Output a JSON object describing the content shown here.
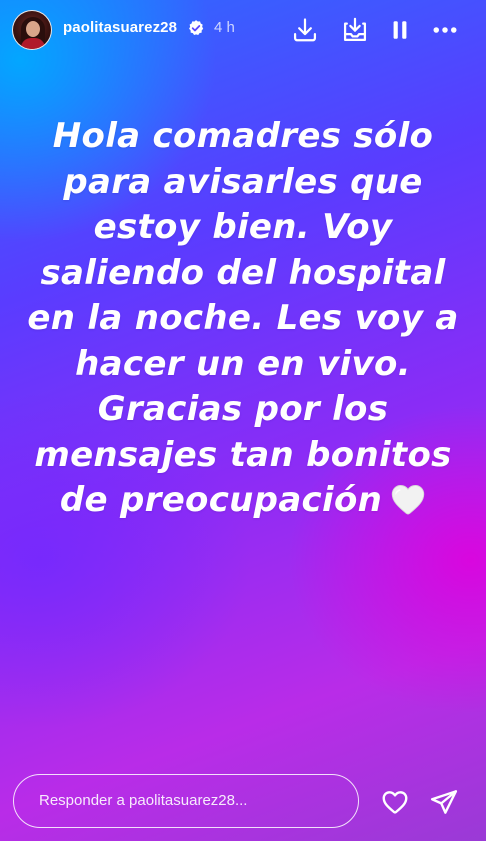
{
  "header": {
    "username": "paolitasuarez28",
    "time_ago": "4 h",
    "verified": true,
    "icons": [
      "download-icon",
      "save-stack-icon",
      "pause-icon",
      "more-icon"
    ]
  },
  "story": {
    "lines": [
      "Hola comadres sólo",
      "para avisarles que",
      "estoy bien. Voy",
      "saliendo del hospital",
      "en la noche. Les voy a",
      "hacer un en vivo.",
      "Gracias por los",
      "mensajes tan bonitos",
      "de preocupación"
    ],
    "trailing_emoji": "white-heart",
    "background_colors": [
      "#00aaff",
      "#5a3cff",
      "#8a2cf6",
      "#e100dc"
    ]
  },
  "reply": {
    "placeholder": "Responder a paolitasuarez28..."
  },
  "actions": {
    "icons": [
      "heart-icon",
      "send-icon"
    ]
  }
}
